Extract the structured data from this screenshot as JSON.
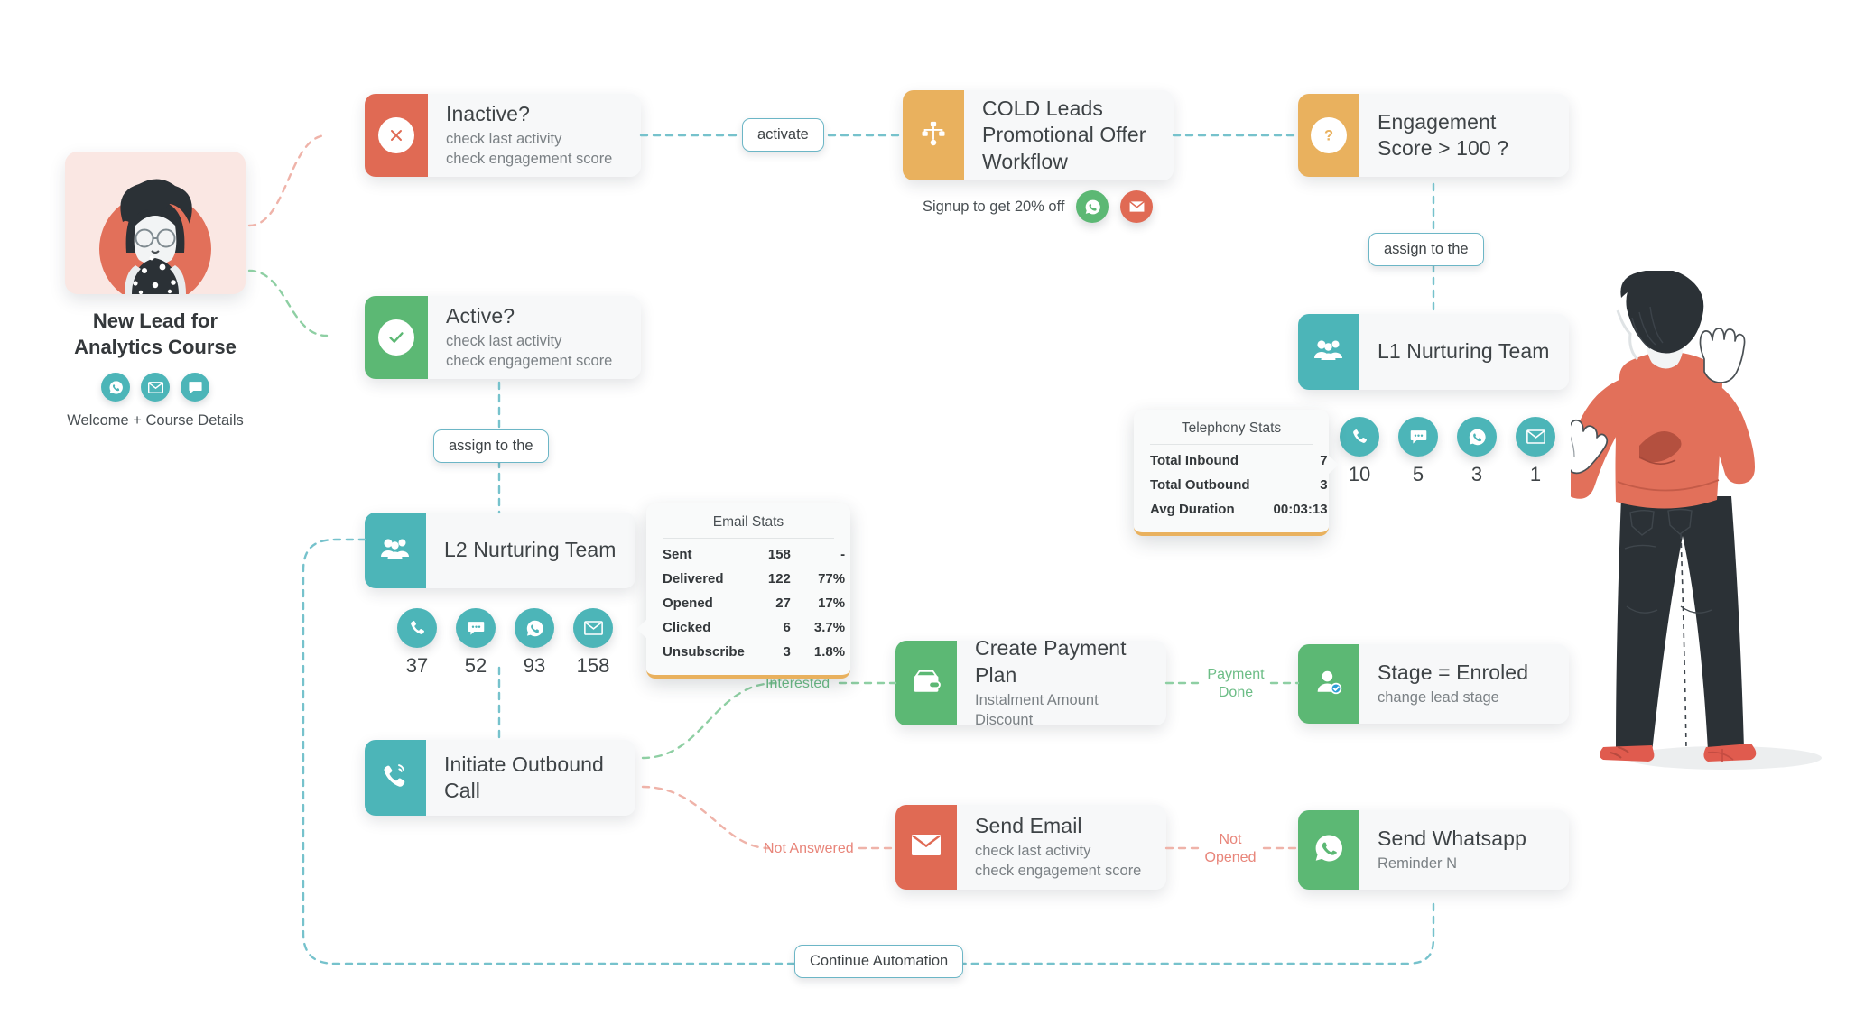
{
  "lead": {
    "title_line1": "New Lead for",
    "title_line2": "Analytics Course",
    "channels": [
      "whatsapp-icon",
      "email-icon",
      "sms-icon"
    ],
    "subtitle": "Welcome + Course Details"
  },
  "nodes": {
    "inactive": {
      "title": "Inactive?",
      "sub1": "check last activity",
      "sub2": "check engagement score",
      "icon": "x-circle-icon",
      "color": "#e06a54"
    },
    "active": {
      "title": "Active?",
      "sub1": "check last activity",
      "sub2": "check engagement score",
      "icon": "check-circle-icon",
      "color": "#5cb874"
    },
    "cold": {
      "title_line1": "COLD Leads",
      "title_line2": "Promotional Offer",
      "title_line3": "Workflow",
      "icon": "workflow-icon",
      "color": "#e9b15e"
    },
    "engagement": {
      "title_line1": "Engagement",
      "title_line2": "Score > 100 ?",
      "icon": "question-circle-icon",
      "color": "#e9b15e"
    },
    "l1team": {
      "title": "L1 Nurturing Team",
      "icon": "team-icon",
      "color": "#4cb5b8"
    },
    "l2team": {
      "title": "L2 Nurturing Team",
      "icon": "team-icon",
      "color": "#4cb5b8"
    },
    "outbound": {
      "title": "Initiate Outbound Call",
      "icon": "phone-outbound-icon",
      "color": "#4cb5b8"
    },
    "payment": {
      "title": "Create Payment Plan",
      "sub1": "Instalment Amount",
      "sub2": "Discount",
      "icon": "wallet-icon",
      "color": "#5cb874"
    },
    "enroled": {
      "title": "Stage = Enroled",
      "sub1": "change lead stage",
      "icon": "user-check-icon",
      "color": "#5cb874"
    },
    "sendemail": {
      "title": "Send Email",
      "sub1": "check last activity",
      "sub2": "check engagement score",
      "icon": "envelope-icon",
      "color": "#e06a54"
    },
    "sendwa": {
      "title": "Send Whatsapp",
      "sub1": "Reminder N",
      "icon": "whatsapp-icon",
      "color": "#5cb874"
    }
  },
  "promo": {
    "text": "Signup to get 20% off",
    "channels": [
      "whatsapp-icon",
      "email-icon"
    ]
  },
  "edge_labels": {
    "activate": "activate",
    "assign_to_the_top": "assign to the",
    "assign_to_the_left": "assign to the",
    "continue_automation": "Continue Automation",
    "interested": "Interested",
    "payment_done_line1": "Payment",
    "payment_done_line2": "Done",
    "not_answered": "Not Answered",
    "not_opened_line1": "Not",
    "not_opened_line2": "Opened"
  },
  "l1_channels": [
    {
      "icon": "phone-icon",
      "count": "10"
    },
    {
      "icon": "sms-icon",
      "count": "5"
    },
    {
      "icon": "whatsapp-icon",
      "count": "3"
    },
    {
      "icon": "email-icon",
      "count": "1"
    }
  ],
  "l2_channels": [
    {
      "icon": "phone-icon",
      "count": "37"
    },
    {
      "icon": "sms-icon",
      "count": "52"
    },
    {
      "icon": "whatsapp-icon",
      "count": "93"
    },
    {
      "icon": "email-icon",
      "count": "158"
    }
  ],
  "telephony_stats": {
    "title": "Telephony Stats",
    "rows": [
      {
        "k": "Total Inbound",
        "v": "7"
      },
      {
        "k": "Total Outbound",
        "v": "3"
      },
      {
        "k": "Avg Duration",
        "v": "00:03:13"
      }
    ]
  },
  "email_stats": {
    "title": "Email Stats",
    "rows": [
      {
        "k": "Sent",
        "v": "158",
        "p": "-"
      },
      {
        "k": "Delivered",
        "v": "122",
        "p": "77%"
      },
      {
        "k": "Opened",
        "v": "27",
        "p": "17%"
      },
      {
        "k": "Clicked",
        "v": "6",
        "p": "3.7%"
      },
      {
        "k": "Unsubscribe",
        "v": "3",
        "p": "1.8%"
      }
    ]
  },
  "colors": {
    "red": "#e06a54",
    "green": "#5cb874",
    "teal": "#4cb5b8",
    "orange": "#e9b15e",
    "edge_teal": "#76c2cc",
    "edge_green": "#8ecfa3",
    "edge_red": "#efb3a9"
  }
}
